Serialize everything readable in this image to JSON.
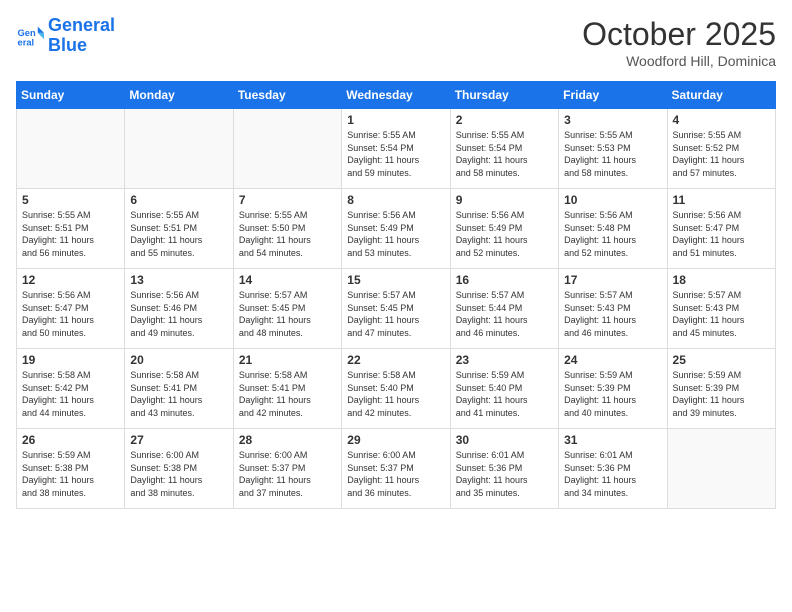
{
  "header": {
    "logo_general": "General",
    "logo_blue": "Blue",
    "month": "October 2025",
    "location": "Woodford Hill, Dominica"
  },
  "days_of_week": [
    "Sunday",
    "Monday",
    "Tuesday",
    "Wednesday",
    "Thursday",
    "Friday",
    "Saturday"
  ],
  "weeks": [
    [
      {
        "day": "",
        "info": ""
      },
      {
        "day": "",
        "info": ""
      },
      {
        "day": "",
        "info": ""
      },
      {
        "day": "1",
        "info": "Sunrise: 5:55 AM\nSunset: 5:54 PM\nDaylight: 11 hours\nand 59 minutes."
      },
      {
        "day": "2",
        "info": "Sunrise: 5:55 AM\nSunset: 5:54 PM\nDaylight: 11 hours\nand 58 minutes."
      },
      {
        "day": "3",
        "info": "Sunrise: 5:55 AM\nSunset: 5:53 PM\nDaylight: 11 hours\nand 58 minutes."
      },
      {
        "day": "4",
        "info": "Sunrise: 5:55 AM\nSunset: 5:52 PM\nDaylight: 11 hours\nand 57 minutes."
      }
    ],
    [
      {
        "day": "5",
        "info": "Sunrise: 5:55 AM\nSunset: 5:51 PM\nDaylight: 11 hours\nand 56 minutes."
      },
      {
        "day": "6",
        "info": "Sunrise: 5:55 AM\nSunset: 5:51 PM\nDaylight: 11 hours\nand 55 minutes."
      },
      {
        "day": "7",
        "info": "Sunrise: 5:55 AM\nSunset: 5:50 PM\nDaylight: 11 hours\nand 54 minutes."
      },
      {
        "day": "8",
        "info": "Sunrise: 5:56 AM\nSunset: 5:49 PM\nDaylight: 11 hours\nand 53 minutes."
      },
      {
        "day": "9",
        "info": "Sunrise: 5:56 AM\nSunset: 5:49 PM\nDaylight: 11 hours\nand 52 minutes."
      },
      {
        "day": "10",
        "info": "Sunrise: 5:56 AM\nSunset: 5:48 PM\nDaylight: 11 hours\nand 52 minutes."
      },
      {
        "day": "11",
        "info": "Sunrise: 5:56 AM\nSunset: 5:47 PM\nDaylight: 11 hours\nand 51 minutes."
      }
    ],
    [
      {
        "day": "12",
        "info": "Sunrise: 5:56 AM\nSunset: 5:47 PM\nDaylight: 11 hours\nand 50 minutes."
      },
      {
        "day": "13",
        "info": "Sunrise: 5:56 AM\nSunset: 5:46 PM\nDaylight: 11 hours\nand 49 minutes."
      },
      {
        "day": "14",
        "info": "Sunrise: 5:57 AM\nSunset: 5:45 PM\nDaylight: 11 hours\nand 48 minutes."
      },
      {
        "day": "15",
        "info": "Sunrise: 5:57 AM\nSunset: 5:45 PM\nDaylight: 11 hours\nand 47 minutes."
      },
      {
        "day": "16",
        "info": "Sunrise: 5:57 AM\nSunset: 5:44 PM\nDaylight: 11 hours\nand 46 minutes."
      },
      {
        "day": "17",
        "info": "Sunrise: 5:57 AM\nSunset: 5:43 PM\nDaylight: 11 hours\nand 46 minutes."
      },
      {
        "day": "18",
        "info": "Sunrise: 5:57 AM\nSunset: 5:43 PM\nDaylight: 11 hours\nand 45 minutes."
      }
    ],
    [
      {
        "day": "19",
        "info": "Sunrise: 5:58 AM\nSunset: 5:42 PM\nDaylight: 11 hours\nand 44 minutes."
      },
      {
        "day": "20",
        "info": "Sunrise: 5:58 AM\nSunset: 5:41 PM\nDaylight: 11 hours\nand 43 minutes."
      },
      {
        "day": "21",
        "info": "Sunrise: 5:58 AM\nSunset: 5:41 PM\nDaylight: 11 hours\nand 42 minutes."
      },
      {
        "day": "22",
        "info": "Sunrise: 5:58 AM\nSunset: 5:40 PM\nDaylight: 11 hours\nand 42 minutes."
      },
      {
        "day": "23",
        "info": "Sunrise: 5:59 AM\nSunset: 5:40 PM\nDaylight: 11 hours\nand 41 minutes."
      },
      {
        "day": "24",
        "info": "Sunrise: 5:59 AM\nSunset: 5:39 PM\nDaylight: 11 hours\nand 40 minutes."
      },
      {
        "day": "25",
        "info": "Sunrise: 5:59 AM\nSunset: 5:39 PM\nDaylight: 11 hours\nand 39 minutes."
      }
    ],
    [
      {
        "day": "26",
        "info": "Sunrise: 5:59 AM\nSunset: 5:38 PM\nDaylight: 11 hours\nand 38 minutes."
      },
      {
        "day": "27",
        "info": "Sunrise: 6:00 AM\nSunset: 5:38 PM\nDaylight: 11 hours\nand 38 minutes."
      },
      {
        "day": "28",
        "info": "Sunrise: 6:00 AM\nSunset: 5:37 PM\nDaylight: 11 hours\nand 37 minutes."
      },
      {
        "day": "29",
        "info": "Sunrise: 6:00 AM\nSunset: 5:37 PM\nDaylight: 11 hours\nand 36 minutes."
      },
      {
        "day": "30",
        "info": "Sunrise: 6:01 AM\nSunset: 5:36 PM\nDaylight: 11 hours\nand 35 minutes."
      },
      {
        "day": "31",
        "info": "Sunrise: 6:01 AM\nSunset: 5:36 PM\nDaylight: 11 hours\nand 34 minutes."
      },
      {
        "day": "",
        "info": ""
      }
    ]
  ]
}
